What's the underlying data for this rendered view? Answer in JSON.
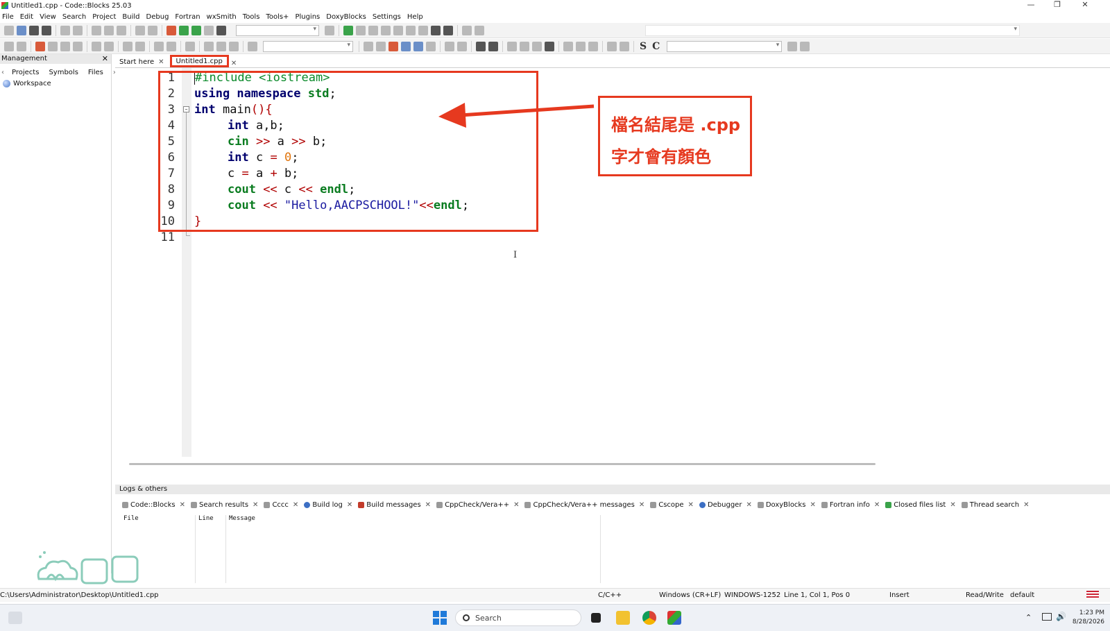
{
  "window": {
    "title": "Untitled1.cpp - Code::Blocks 25.03"
  },
  "menu": [
    "File",
    "Edit",
    "View",
    "Search",
    "Project",
    "Build",
    "Debug",
    "Fortran",
    "wxSmith",
    "Tools",
    "Tools+",
    "Plugins",
    "DoxyBlocks",
    "Settings",
    "Help"
  ],
  "management": {
    "header": "Management",
    "tabs": [
      "Projects",
      "Symbols",
      "Files"
    ],
    "workspace": "Workspace"
  },
  "editor_tabs": [
    {
      "label": "Start here",
      "active": false
    },
    {
      "label": "Untitled1.cpp",
      "active": true
    }
  ],
  "code": {
    "line_numbers": [
      "1",
      "2",
      "3",
      "4",
      "5",
      "6",
      "7",
      "8",
      "9",
      "10",
      "11"
    ],
    "lines": {
      "l1": "#include <iostream>",
      "l2a": "using namespace",
      "l2b": " std",
      "l2c": ";",
      "l3a": "int",
      "l3b": " main",
      "l3c": "(){",
      "l4a": "int",
      "l4b": " a,b;",
      "l5a": "cin",
      "l5b": " >> ",
      "l5c": "a",
      "l5d": " >> ",
      "l5e": "b;",
      "l6a": "int",
      "l6b": " c ",
      "l6c": "=",
      "l6d": " ",
      "l6e": "0",
      "l6f": ";",
      "l7a": "c ",
      "l7b": "=",
      "l7c": " a ",
      "l7d": "+",
      "l7e": " b;",
      "l8a": "cout",
      "l8b": " << ",
      "l8c": "c",
      "l8d": " << ",
      "l8e": "endl",
      "l8f": ";",
      "l9a": "cout",
      "l9b": " << ",
      "l9c": "\"Hello,AACPSCHOOL!\"",
      "l9d": "<<",
      "l9e": "endl",
      "l9f": ";",
      "l10": "}"
    }
  },
  "callout": {
    "line1": "檔名結尾是 .cpp",
    "line2": "字才會有顏色"
  },
  "logs": {
    "header": "Logs & others",
    "tabs": [
      "Code::Blocks",
      "Search results",
      "Cccc",
      "Build log",
      "Build messages",
      "CppCheck/Vera++",
      "CppCheck/Vera++ messages",
      "Cscope",
      "Debugger",
      "DoxyBlocks",
      "Fortran info",
      "Closed files list",
      "Thread search"
    ],
    "columns": [
      "File",
      "Line",
      "Message"
    ]
  },
  "statusbar": {
    "path": "C:\\Users\\Administrator\\Desktop\\Untitled1.cpp",
    "language": "C/C++",
    "eol": "Windows (CR+LF)",
    "encoding": "WINDOWS-1252",
    "position": "Line 1, Col 1, Pos 0",
    "mode": "Insert",
    "access": "Read/Write",
    "profile": "default"
  },
  "taskbar": {
    "search_placeholder": "Search",
    "time": "1:23 PM",
    "date": "8/28/2026"
  },
  "colors": {
    "highlight_red": "#e6391f",
    "preprocessor": "#0a8a2a",
    "keyword": "#00006e"
  }
}
